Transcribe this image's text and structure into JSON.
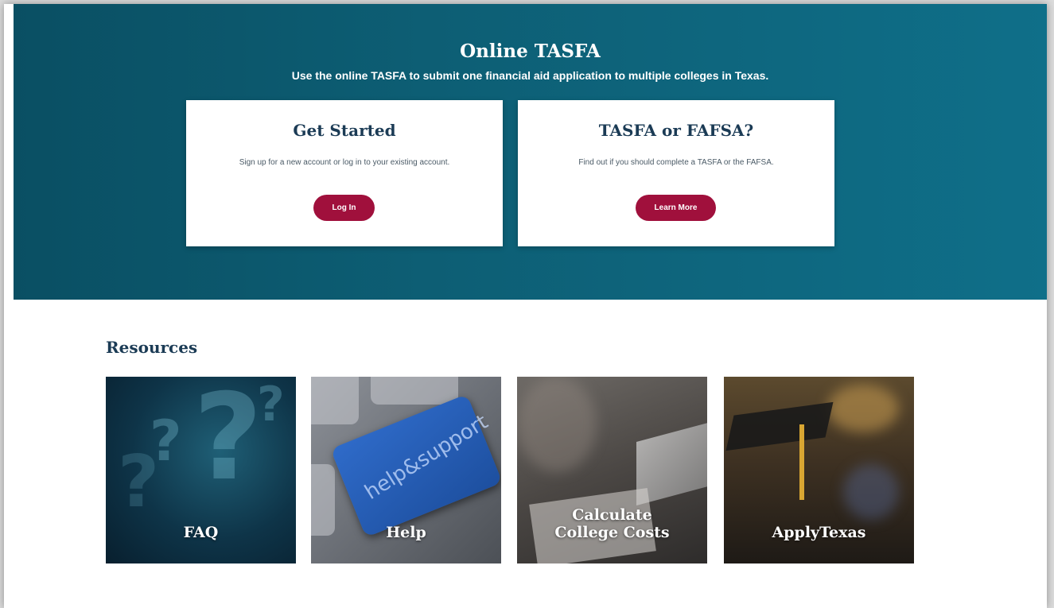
{
  "hero": {
    "title": "Online TASFA",
    "subtitle_pre": "Use the online TASFA to submit ",
    "subtitle_em1": "one",
    "subtitle_mid": " financial aid application to ",
    "subtitle_em2": "multiple",
    "subtitle_post": " colleges in Texas."
  },
  "cards": [
    {
      "title": "Get Started",
      "text": "Sign up for a new account or log in to your existing account.",
      "button": "Log In"
    },
    {
      "title": "TASFA or FAFSA?",
      "text": "Find out if you should complete a TASFA or the FAFSA.",
      "button": "Learn More"
    }
  ],
  "resources": {
    "heading": "Resources",
    "tiles": [
      {
        "label": "FAQ",
        "icon": "question-marks-image"
      },
      {
        "label": "Help",
        "icon": "keyboard-help-support-image",
        "key_text": "help&support"
      },
      {
        "label_line1": "Calculate",
        "label_line2": "College Costs",
        "icon": "calculator-desk-image"
      },
      {
        "label": "ApplyTexas",
        "icon": "graduation-cap-image"
      }
    ]
  },
  "colors": {
    "hero_bg": "#0d5e74",
    "button": "#a0103c",
    "heading": "#1b3b55"
  }
}
